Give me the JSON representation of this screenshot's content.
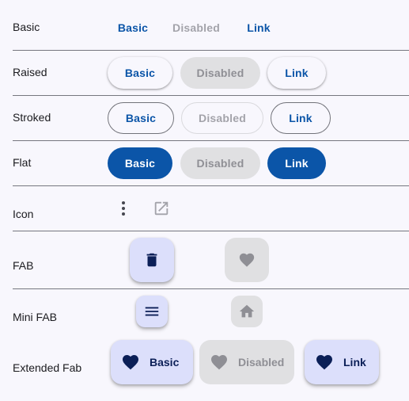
{
  "rows": {
    "basic": {
      "label": "Basic",
      "buttons": [
        "Basic",
        "Disabled",
        "Link"
      ]
    },
    "raised": {
      "label": "Raised",
      "buttons": [
        "Basic",
        "Disabled",
        "Link"
      ]
    },
    "stroked": {
      "label": "Stroked",
      "buttons": [
        "Basic",
        "Disabled",
        "Link"
      ]
    },
    "flat": {
      "label": "Flat",
      "buttons": [
        "Basic",
        "Disabled",
        "Link"
      ]
    },
    "icon": {
      "label": "Icon",
      "icons": [
        "more-vert-icon",
        "open-in-new-icon"
      ]
    },
    "fab": {
      "label": "FAB",
      "icons": [
        "delete-icon",
        "favorite-icon"
      ]
    },
    "mini_fab": {
      "label": "Mini FAB",
      "icons": [
        "menu-icon",
        "home-icon"
      ]
    },
    "extended_fab": {
      "label": "Extended Fab",
      "buttons": [
        "Basic",
        "Disabled",
        "Link"
      ],
      "icon": "favorite-icon"
    }
  },
  "colors": {
    "primary": "#0b55a8",
    "fab_container": "#dcdffb",
    "on_fab": "#0b1f57",
    "disabled_container": "#e0e0e2",
    "disabled_text": "#a3a3aa",
    "background": "#f8f7fd"
  }
}
